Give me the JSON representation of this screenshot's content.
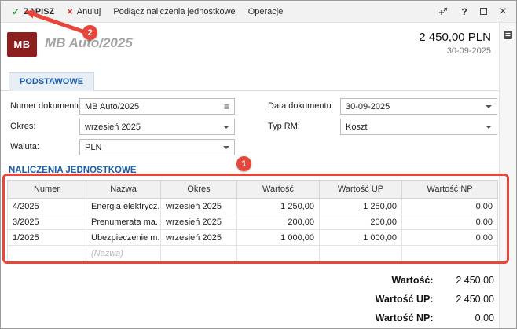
{
  "colors": {
    "accent_blue": "#1d5fa6",
    "avatar_bg": "#8e1f1f",
    "annotation_red": "#e8463a",
    "save_green": "#2f9e44",
    "cancel_red": "#cf3a2b"
  },
  "icons": {
    "check": "✓",
    "cross": "×",
    "hamburger": "≡",
    "help": "?",
    "close": "×"
  },
  "toolbar": {
    "save": "ZAPISZ",
    "cancel": "Anuluj",
    "menu1": "Podłącz naliczenia jednostkowe",
    "menu2": "Operacje"
  },
  "header": {
    "avatar": "MB",
    "title": "MB Auto/2025",
    "amount": "2 450,00 PLN",
    "date": "30-09-2025"
  },
  "tab": "PODSTAWOWE",
  "form": {
    "numer_label": "Numer dokumentu:",
    "numer_value": "MB Auto/2025",
    "okres_label": "Okres:",
    "okres_value": "wrzesień 2025",
    "waluta_label": "Waluta:",
    "waluta_value": "PLN",
    "data_label": "Data dokumentu:",
    "data_value": "30-09-2025",
    "typ_label": "Typ RM:",
    "typ_value": "Koszt"
  },
  "section_title": "NALICZENIA JEDNOSTKOWE",
  "table": {
    "columns": [
      "Numer",
      "Nazwa",
      "Okres",
      "Wartość",
      "Wartość UP",
      "Wartość NP"
    ],
    "rows": [
      [
        "4/2025",
        "Energia elektrycz...",
        "wrzesień 2025",
        "1 250,00",
        "1 250,00",
        "0,00"
      ],
      [
        "3/2025",
        "Prenumerata ma...",
        "wrzesień 2025",
        "200,00",
        "200,00",
        "0,00"
      ],
      [
        "1/2025",
        "Ubezpieczenie m...",
        "wrzesień 2025",
        "1 000,00",
        "1 000,00",
        "0,00"
      ]
    ],
    "new_row_placeholder": "(Nazwa)"
  },
  "totals": [
    {
      "label": "Wartość:",
      "value": "2 450,00"
    },
    {
      "label": "Wartość UP:",
      "value": "2 450,00"
    },
    {
      "label": "Wartość NP:",
      "value": "0,00"
    }
  ],
  "annotations": {
    "badge_save": "2",
    "badge_table": "1"
  }
}
